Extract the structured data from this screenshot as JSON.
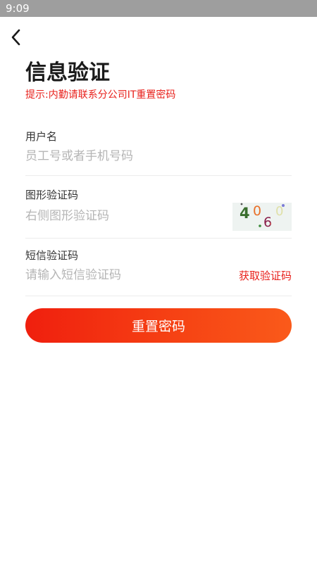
{
  "status_bar": {
    "time": "9:09"
  },
  "header": {
    "back_icon": "chevron-left-icon"
  },
  "page": {
    "title": "信息验证",
    "hint": "提示:内勤请联系分公司IT重置密码"
  },
  "form": {
    "username": {
      "label": "用户名",
      "placeholder": "员工号或者手机号码",
      "value": ""
    },
    "captcha": {
      "label": "图形验证码",
      "placeholder": "右侧图形验证码",
      "value": "",
      "image_text": "4060"
    },
    "sms": {
      "label": "短信验证码",
      "placeholder": "请输入短信验证码",
      "value": "",
      "get_code_label": "获取验证码"
    }
  },
  "actions": {
    "reset_label": "重置密码"
  },
  "colors": {
    "accent": "#e8201b",
    "button_start": "#f01f0e",
    "button_end": "#fa5a1a",
    "status_bar": "#9e9e9e"
  }
}
